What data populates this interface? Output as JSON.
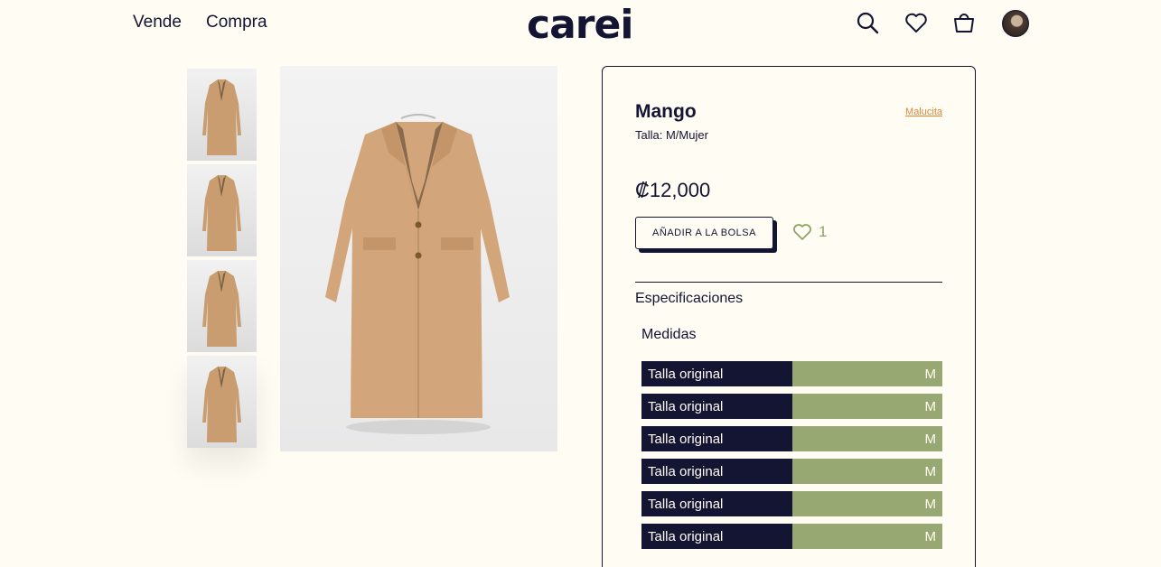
{
  "header": {
    "nav": [
      {
        "label": "Vende"
      },
      {
        "label": "Compra"
      }
    ],
    "logo": "carei",
    "icons": [
      "search-icon",
      "heart-icon",
      "bag-icon",
      "avatar"
    ]
  },
  "gallery": {
    "thumbnails": 4
  },
  "product": {
    "brand": "Mango",
    "seller": "Malucita",
    "size": "Talla: M/Mujer",
    "price": "₡12,000",
    "add_button": "AÑADIR A LA BOLSA",
    "likes": "1",
    "specs_title": "Especificaciones",
    "measures_title": "Medidas",
    "measures": [
      {
        "label": "Talla original",
        "value": "M"
      },
      {
        "label": "Talla original",
        "value": "M"
      },
      {
        "label": "Talla original",
        "value": "M"
      },
      {
        "label": "Talla original",
        "value": "M"
      },
      {
        "label": "Talla original",
        "value": "M"
      },
      {
        "label": "Talla original",
        "value": "M"
      }
    ]
  },
  "colors": {
    "background": "#fffcf3",
    "navy": "#141433",
    "olive": "#98a872",
    "link": "#e0863a",
    "coat": "#d2a67a"
  }
}
